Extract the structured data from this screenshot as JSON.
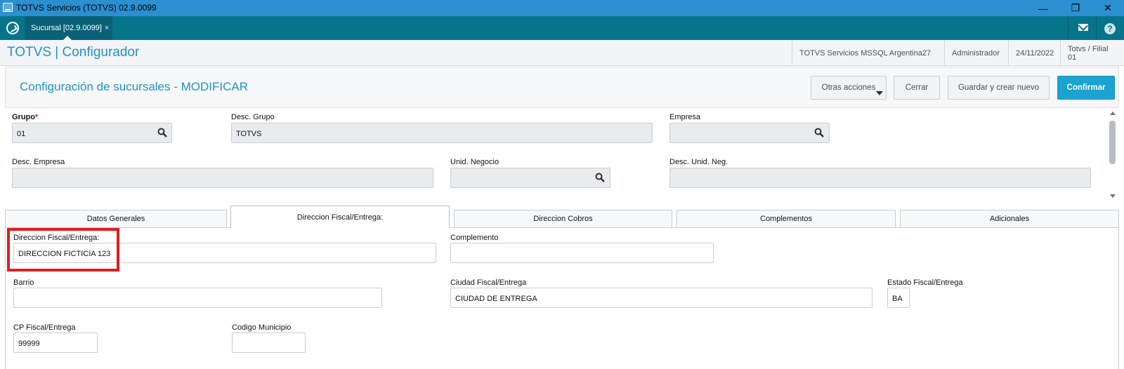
{
  "window": {
    "title": "TOTVS Servicios (TOTVS) 02.9.0099",
    "controls": {
      "minimize": "—",
      "maximize": "❐",
      "close": "✕"
    }
  },
  "tabbar": {
    "tab_label": "Sucursal [02.9.0099]",
    "tab_close": "×",
    "help": "?"
  },
  "header": {
    "brand": "TOTVS | Configurador",
    "server": "TOTVS Servicios MSSQL Argentina27",
    "user": "Administrador",
    "date": "24/11/2022",
    "branch": "Totvs / Filial 01"
  },
  "page": {
    "title": "Configuración de sucursales - MODIFICAR",
    "buttons": {
      "other_actions": "Otras acciones",
      "close": "Cerrar",
      "save_new": "Guardar y crear nuevo",
      "confirm": "Confirmar"
    }
  },
  "form": {
    "grupo": {
      "label": "Grupo",
      "required": "*",
      "value": "01"
    },
    "desc_grupo": {
      "label": "Desc. Grupo",
      "value": "TOTVS"
    },
    "empresa": {
      "label": "Empresa",
      "value": ""
    },
    "desc_empresa": {
      "label": "Desc. Empresa",
      "value": ""
    },
    "unid_negocio": {
      "label": "Unid. Negocio",
      "value": ""
    },
    "desc_unid_neg": {
      "label": "Desc. Unid. Neg.",
      "value": ""
    }
  },
  "tabs": [
    {
      "label": "Datos Generales",
      "active": false
    },
    {
      "label": "Direccion Fiscal/Entrega:",
      "active": true
    },
    {
      "label": "Direccion Cobros",
      "active": false
    },
    {
      "label": "Complementos",
      "active": false
    },
    {
      "label": "Adicionales",
      "active": false
    }
  ],
  "fiscal": {
    "direccion": {
      "label": "Direccion Fiscal/Entrega:",
      "value": "DIRECCION FICTICIA 123"
    },
    "complemento": {
      "label": "Complemento",
      "value": ""
    },
    "barrio": {
      "label": "Barrio",
      "value": ""
    },
    "ciudad": {
      "label": "Ciudad Fiscal/Entrega",
      "value": "CIUDAD DE ENTREGA"
    },
    "estado": {
      "label": "Estado Fiscal/Entrega",
      "value": "BA"
    },
    "cp": {
      "label": "CP Fiscal/Entrega",
      "value": "99999"
    },
    "municipio": {
      "label": "Codigo Municipio",
      "value": ""
    }
  },
  "colors": {
    "titlebar": "#2b8fd0",
    "tabbar": "#06748b",
    "accent": "#1f93c6",
    "primary_button": "#1aa2d1",
    "highlight": "#e11b22"
  }
}
